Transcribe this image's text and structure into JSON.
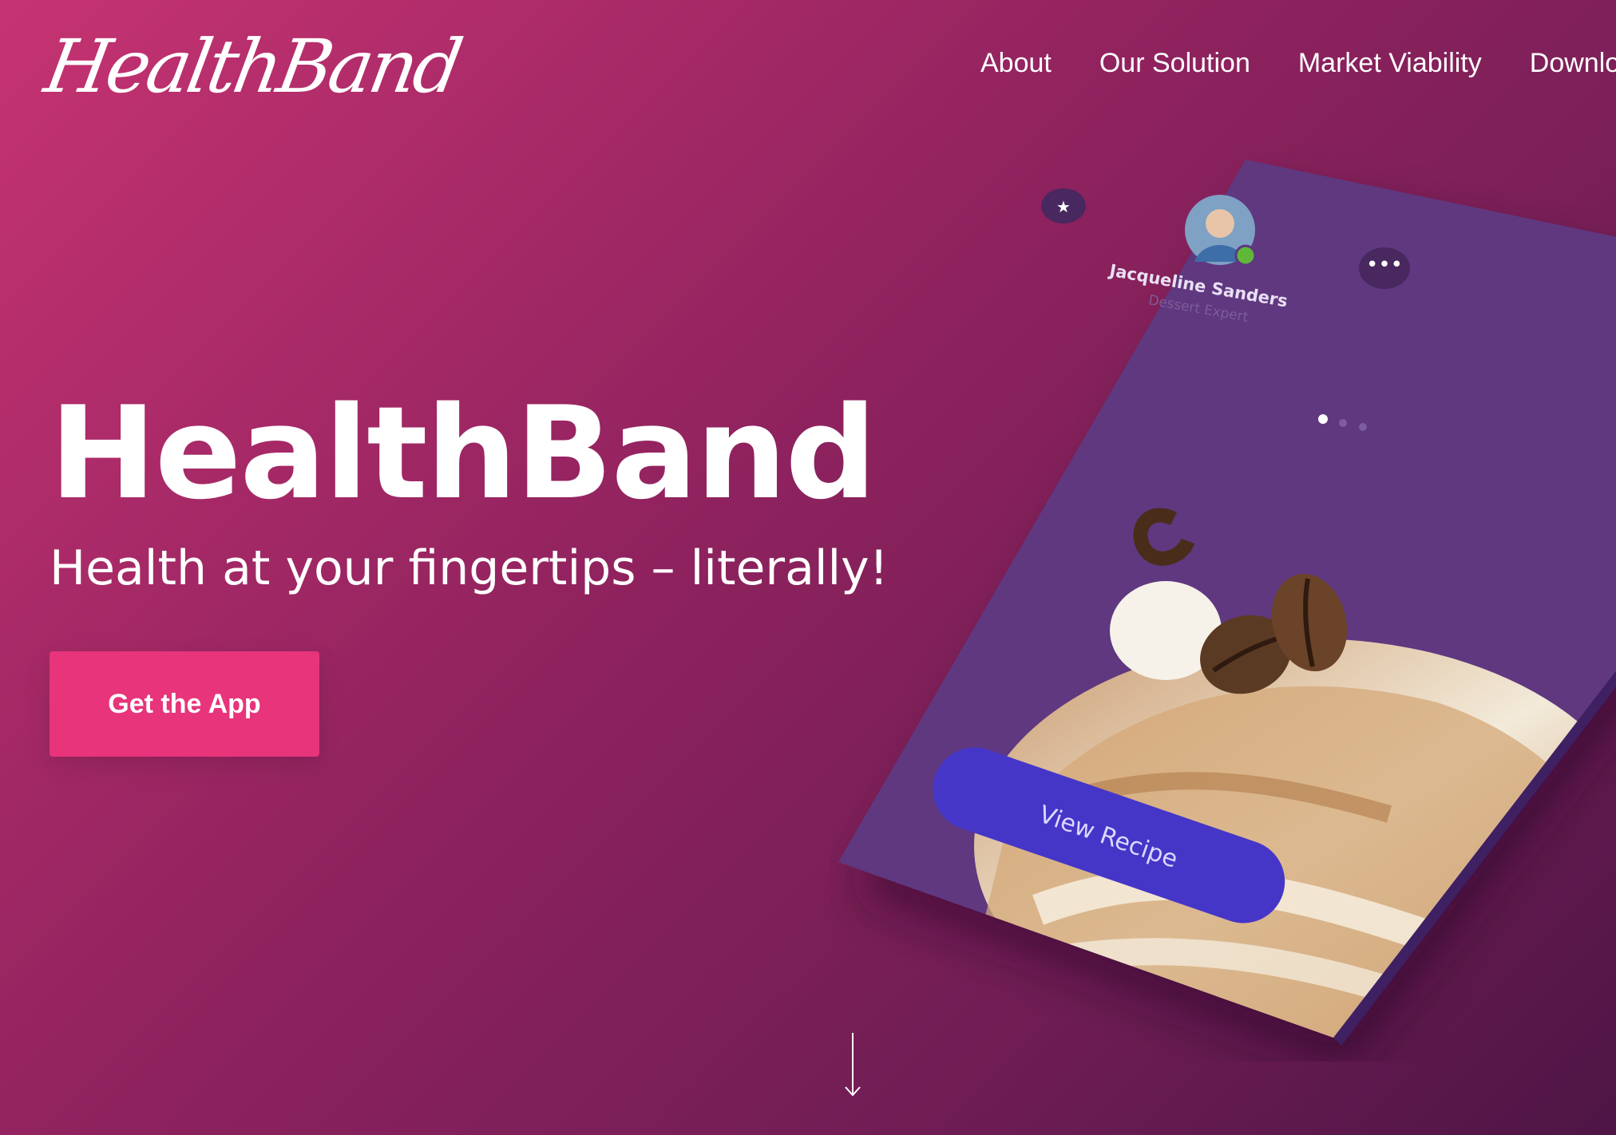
{
  "brand": {
    "logo_text": "HealthBand"
  },
  "nav": {
    "items": [
      {
        "label": "About"
      },
      {
        "label": "Our Solution"
      },
      {
        "label": "Market Viability"
      },
      {
        "label": "Download"
      }
    ]
  },
  "hero": {
    "title": "HealthBand",
    "subtitle": "Health at your fingertips – literally!",
    "cta_label": "Get the App"
  },
  "phone": {
    "user_name": "Jacqueline Sanders",
    "user_role": "Dessert Expert",
    "button_label": "View Recipe",
    "pager_total": 3,
    "pager_active": 1,
    "status_color": "#5fb83a",
    "button_color": "#4536c8",
    "screen_color": "#5e3780"
  },
  "colors": {
    "cta": "#e7347a",
    "bg_start": "#c63372",
    "bg_end": "#4e1545"
  },
  "icons": {
    "scroll": "arrow-down-icon",
    "favorite": "star-icon",
    "more": "more-dots-icon"
  }
}
